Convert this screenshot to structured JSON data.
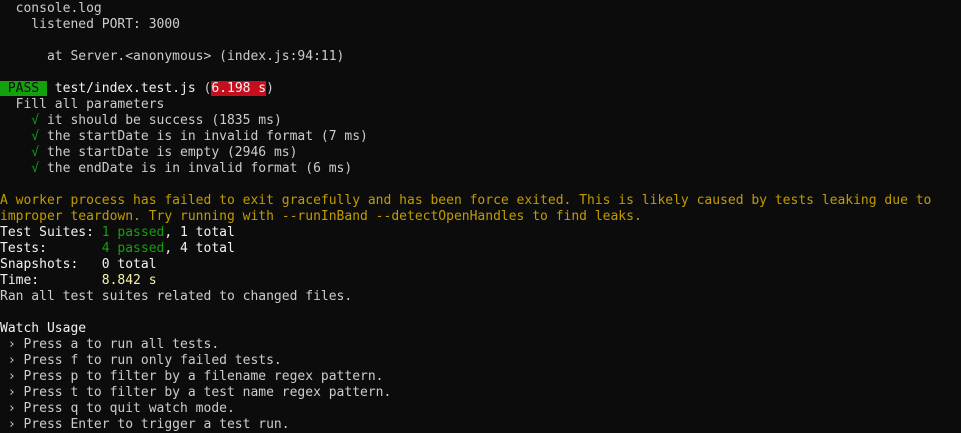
{
  "console": {
    "header": "  console.log",
    "listened": "    listened PORT: 3000",
    "blank": "",
    "trace": "      at Server.<anonymous> (index.js:94:11)"
  },
  "result": {
    "pass_badge": " PASS ",
    "file": " test/index.test.js ",
    "open_paren": "(",
    "duration": "6.198 s",
    "close_paren": ")"
  },
  "suite": {
    "name": "  Fill all parameters",
    "tests": [
      {
        "check": "    √",
        "label": " it should be success (1835 ms)"
      },
      {
        "check": "    √",
        "label": " the startDate is in invalid format (7 ms)"
      },
      {
        "check": "    √",
        "label": " the startDate is empty (2946 ms)"
      },
      {
        "check": "    √",
        "label": " the endDate is in invalid format (6 ms)"
      }
    ]
  },
  "warning": {
    "line1": "A worker process has failed to exit gracefully and has been force exited. This is likely caused by tests leaking due to",
    "line2": "improper teardown. Try running with --runInBand --detectOpenHandles to find leaks."
  },
  "summary": {
    "suites_label": "Test Suites: ",
    "suites_passed": "1 passed",
    "suites_rest": ", 1 total",
    "tests_label": "Tests:       ",
    "tests_passed": "4 passed",
    "tests_rest": ", 4 total",
    "snapshots_label": "Snapshots:   ",
    "snapshots_value": "0 total",
    "time_label": "Time:        ",
    "time_value": "8.842 s",
    "ran": "Ran all test suites related to changed files."
  },
  "watch": {
    "title": "Watch Usage",
    "items": [
      " › Press a to run all tests.",
      " › Press f to run only failed tests.",
      " › Press p to filter by a filename regex pattern.",
      " › Press t to filter by a test name regex pattern.",
      " › Press q to quit watch mode.",
      " › Press Enter to trigger a test run."
    ]
  },
  "colors": {
    "background": "#0c0c0c",
    "text": "#cccccc",
    "pass_green": "#13a10e",
    "warning_yellow": "#c19c00",
    "slow_red": "#c50f1f"
  }
}
